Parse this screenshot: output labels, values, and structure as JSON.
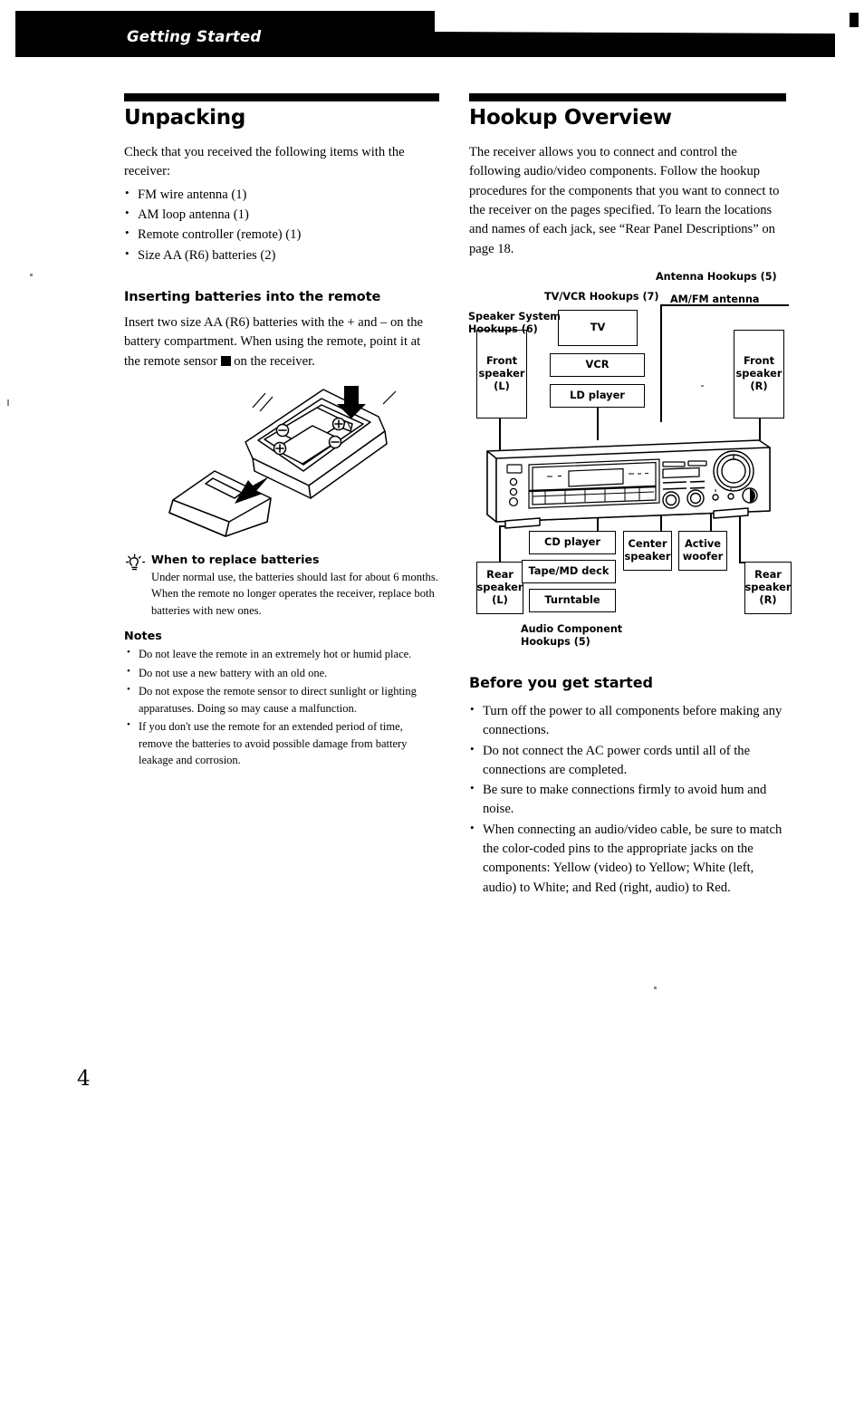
{
  "header": {
    "running_title": "Getting Started"
  },
  "page_number": "4",
  "left_column": {
    "section_title": "Unpacking",
    "intro": "Check that you received the following items with the receiver:",
    "items": [
      "FM wire antenna  (1)",
      "AM loop antenna  (1)",
      "Remote controller (remote)  (1)",
      "Size AA (R6) batteries  (2)"
    ],
    "subsection_title": "Inserting batteries into the remote",
    "subsection_body_part1": "Insert two size AA (R6) batteries with the + and – on the battery compartment. When using the remote, point it at the remote sensor ",
    "remote_sensor_symbol": "remote-sensor-glyph",
    "subsection_body_part2": " on the receiver.",
    "figure_caption": "remote-battery-compartment-illustration",
    "tip": {
      "icon": "lightbulb-tip-icon",
      "title": "When to replace batteries",
      "body": "Under normal use, the batteries should last for about 6 months. When the remote no longer operates the receiver, replace both batteries with new ones."
    },
    "notes": {
      "title": "Notes",
      "items": [
        "Do not leave the remote in an extremely hot or humid place.",
        "Do not use a new battery with an old one.",
        "Do not expose the remote sensor to direct sunlight or lighting apparatuses. Doing so may cause a malfunction.",
        "If you don't use the remote for an extended period of time, remove the batteries to avoid possible damage from battery leakage and corrosion."
      ]
    }
  },
  "right_column": {
    "section_title": "Hookup Overview",
    "intro": "The receiver allows you to connect and control the following audio/video components.  Follow the hookup procedures for the components that you want to connect to the receiver on the pages specified.  To learn the locations and names of each jack, see “Rear Panel Descriptions” on page 18.",
    "diagram": {
      "group_labels": {
        "speaker_system": "Speaker System\nHookups (6)",
        "tv_vcr": "TV/VCR Hookups (7)",
        "antenna": "Antenna Hookups (5)",
        "am_fm_antenna": "AM/FM antenna",
        "audio_component": "Audio Component\nHookups (5)"
      },
      "boxes": {
        "front_speaker_l": "Front\nspeaker\n(L)",
        "front_speaker_r": "Front\nspeaker\n(R)",
        "rear_speaker_l": "Rear\nspeaker\n(L)",
        "rear_speaker_r": "Rear\nspeaker\n(R)",
        "tv": "TV",
        "vcr": "VCR",
        "ld_player": "LD player",
        "cd_player": "CD player",
        "tape_md_deck": "Tape/MD deck",
        "turntable": "Turntable",
        "center_speaker": "Center\nspeaker",
        "active_woofer": "Active\nwoofer"
      },
      "receiver": "receiver-front-panel-illustration"
    },
    "before_started": {
      "title": "Before you get started",
      "items": [
        "Turn off the power to all components before making any connections.",
        "Do not connect the AC power cords until all of the connections are completed.",
        "Be sure to make connections firmly to avoid hum and noise.",
        "When connecting an audio/video cable, be sure to match the color-coded pins to the appropriate jacks on the components:  Yellow (video) to Yellow;  White (left, audio) to White;  and Red (right, audio) to Red."
      ]
    }
  }
}
